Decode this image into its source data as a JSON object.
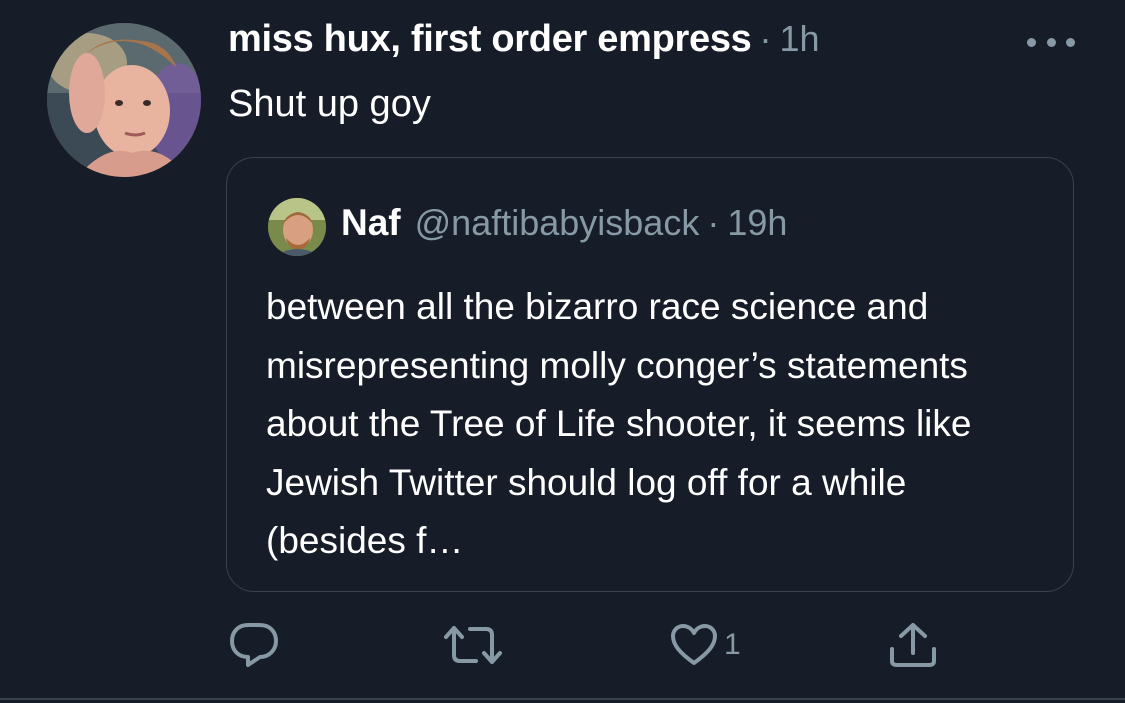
{
  "tweet": {
    "display_name": "miss hux, first order empress",
    "separator": "·",
    "time": "1h",
    "text": "Shut up goy",
    "avatar_icon": "profile-photo",
    "more_icon": "ellipsis-icon"
  },
  "quoted_tweet": {
    "display_name": "Naf",
    "handle": "@naftibabyisback",
    "separator": "·",
    "time": "19h",
    "text": "between all the bizarro race science and misrepresenting molly conger’s statements about the Tree of Life shooter, it seems like Jewish Twitter should log off for a while (besides f…",
    "avatar_icon": "profile-photo"
  },
  "actions": {
    "reply_icon": "reply-icon",
    "retweet_icon": "retweet-icon",
    "like_icon": "heart-icon",
    "like_count": "1",
    "share_icon": "share-icon"
  },
  "colors": {
    "background": "#161d28",
    "text": "#ffffff",
    "secondary_text": "#8899a6",
    "border": "#38444d"
  }
}
